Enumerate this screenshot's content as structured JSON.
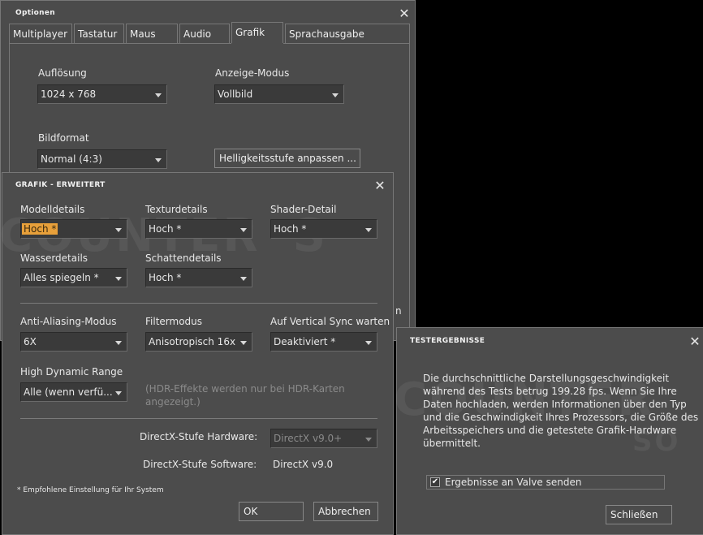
{
  "options": {
    "title": "Optionen",
    "tabs": [
      {
        "label": "Multiplayer"
      },
      {
        "label": "Tastatur"
      },
      {
        "label": "Maus"
      },
      {
        "label": "Audio"
      },
      {
        "label": "Grafik"
      },
      {
        "label": "Sprachausgabe"
      }
    ],
    "active_tab": "Grafik",
    "resolution_label": "Auflösung",
    "resolution_value": "1024 x 768",
    "display_mode_label": "Anzeige-Modus",
    "display_mode_value": "Vollbild",
    "aspect_label": "Bildformat",
    "aspect_value": "Normal (4:3)",
    "brightness_button": "Helligkeitsstufe anpassen ...",
    "partial_text": "n"
  },
  "advanced": {
    "title": "GRAFIK - ERWEITERT",
    "model_label": "Modelldetails",
    "model_value": "Hoch *",
    "texture_label": "Texturdetails",
    "texture_value": "Hoch *",
    "shader_label": "Shader-Detail",
    "shader_value": "Hoch *",
    "water_label": "Wasserdetails",
    "water_value": "Alles spiegeln *",
    "shadow_label": "Schattendetails",
    "shadow_value": "Hoch *",
    "aa_label": "Anti-Aliasing-Modus",
    "aa_value": "6X",
    "filter_label": "Filtermodus",
    "filter_value": "Anisotropisch 16x",
    "vsync_label": "Auf Vertical Sync warten",
    "vsync_value": "Deaktiviert *",
    "hdr_label": "High Dynamic Range",
    "hdr_value": "Alle (wenn verfü...",
    "hdr_note": "(HDR-Effekte werden nur bei HDR-Karten angezeigt.)",
    "dx_hw_label": "DirectX-Stufe Hardware:",
    "dx_hw_value": "DirectX v9.0+",
    "dx_sw_label": "DirectX-Stufe Software:",
    "dx_sw_value": "DirectX v9.0",
    "footnote": "* Empfohlene Einstellung für Ihr System",
    "ok": "OK",
    "cancel": "Abbrechen"
  },
  "test_results": {
    "title": "TESTERGEBNISSE",
    "body_lines": [
      "Die durchschnittliche Darstellungsgeschwindigkeit",
      "während des Tests betrug 199.28 fps. Wenn Sie Ihre",
      "Daten hochladen, werden Informationen über den Typ",
      "und die Geschwindigkeit Ihres Prozessors, die Größe des",
      "Arbeitsspeichers und die getestete Grafik-Hardware",
      "übermittelt."
    ],
    "checkbox_label": "Ergebnisse an Valve senden",
    "checkbox_checked": true,
    "close_button": "Schließen"
  },
  "watermark": {
    "main": "COUNTER",
    "main2": "S",
    "right": "COUNTER",
    "right_sub": "SO"
  },
  "icons": {
    "close": "close-icon",
    "dropdown": "chevron-down-icon",
    "check": "checkmark-icon"
  }
}
